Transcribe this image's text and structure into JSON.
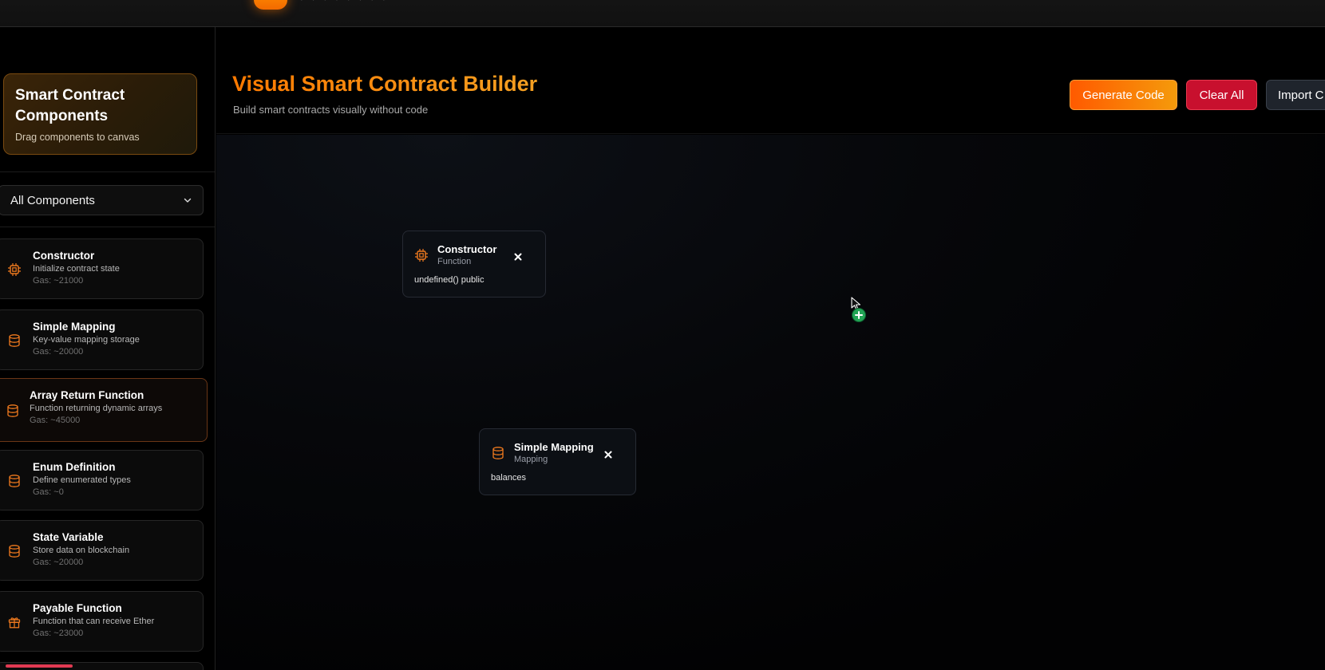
{
  "sidebar": {
    "title": "Smart Contract Components",
    "subtitle": "Drag components to canvas",
    "filter": {
      "selected": "All Components"
    },
    "items": [
      {
        "title": "Constructor",
        "desc": "Initialize contract state",
        "gas": "Gas: ~21000",
        "icon": "chip-icon"
      },
      {
        "title": "Simple Mapping",
        "desc": "Key-value mapping storage",
        "gas": "Gas: ~20000",
        "icon": "database-icon"
      },
      {
        "title": "Array Return Function",
        "desc": "Function returning dynamic arrays",
        "gas": "Gas: ~45000",
        "icon": "database-icon"
      },
      {
        "title": "Enum Definition",
        "desc": "Define enumerated types",
        "gas": "Gas: ~0",
        "icon": "database-icon"
      },
      {
        "title": "State Variable",
        "desc": "Store data on blockchain",
        "gas": "Gas: ~20000",
        "icon": "database-icon"
      },
      {
        "title": "Payable Function",
        "desc": "Function that can receive Ether",
        "gas": "Gas: ~23000",
        "icon": "gift-icon"
      }
    ]
  },
  "header": {
    "title": "Visual Smart Contract Builder",
    "subtitle": "Build smart contracts visually without code",
    "buttons": {
      "generate": "Generate Code",
      "clear": "Clear All",
      "import": "Import C"
    }
  },
  "canvas": {
    "nodes": [
      {
        "title": "Constructor",
        "type": "Function",
        "value": "undefined() public",
        "icon": "chip-icon"
      },
      {
        "title": "Simple Mapping",
        "type": "Mapping",
        "value": "balances",
        "icon": "database-icon"
      }
    ]
  },
  "colors": {
    "accent": "#f7931e",
    "danger": "#c8102e",
    "success": "#22a455"
  }
}
